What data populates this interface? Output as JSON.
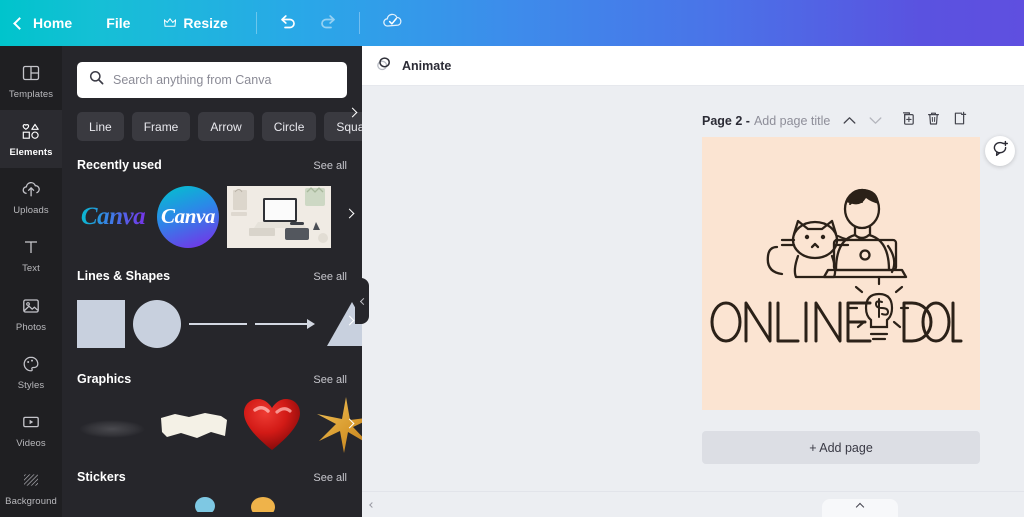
{
  "topbar": {
    "back_label": "Home",
    "back_icon": "chevron-left-icon",
    "file_label": "File",
    "resize_label": "Resize",
    "resize_icon": "crown-icon",
    "undo_icon": "undo-arrow-icon",
    "redo_icon": "redo-arrow-icon",
    "saved_icon": "cloud-check-icon",
    "gradient_start": "#00c4cc",
    "gradient_end": "#5f4fe0"
  },
  "rail": {
    "items": [
      {
        "label": "Templates",
        "icon": "templates-grid-icon",
        "active": false
      },
      {
        "label": "Elements",
        "icon": "elements-shapes-icon",
        "active": true
      },
      {
        "label": "Uploads",
        "icon": "upload-cloud-icon",
        "active": false
      },
      {
        "label": "Text",
        "icon": "text-t-icon",
        "active": false
      },
      {
        "label": "Photos",
        "icon": "photo-image-icon",
        "active": false
      },
      {
        "label": "Styles",
        "icon": "palette-icon",
        "active": false
      },
      {
        "label": "Videos",
        "icon": "video-play-icon",
        "active": false
      },
      {
        "label": "Background",
        "icon": "background-hatch-icon",
        "active": false
      }
    ]
  },
  "panel": {
    "search": {
      "placeholder": "Search anything from Canva",
      "value": "",
      "icon": "search-icon"
    },
    "chips": [
      "Line",
      "Frame",
      "Arrow",
      "Circle",
      "Square"
    ],
    "chips_more_icon": "chevron-right-icon",
    "see_all_label": "See all",
    "sections": [
      {
        "title": "Recently used",
        "items": [
          "canva-wordmark-thumb",
          "canva-circle-logo-thumb",
          "desk-laptop-photo-thumb"
        ],
        "next_icon": "chevron-right-icon"
      },
      {
        "title": "Lines & Shapes",
        "items": [
          "square-shape",
          "circle-shape",
          "line-shape",
          "arrow-shape",
          "triangle-shape"
        ],
        "next_icon": "chevron-right-icon"
      },
      {
        "title": "Graphics",
        "items": [
          "smudge-graphic",
          "torn-paper-graphic",
          "red-heart-graphic",
          "gold-sparkle-graphic"
        ],
        "next_icon": "chevron-right-icon"
      },
      {
        "title": "Stickers",
        "items": [
          "blue-sticker",
          "orange-sticker"
        ],
        "next_icon": "chevron-right-icon"
      }
    ],
    "canva_wordmark": "Canva",
    "canva_circlemark": "Canva",
    "collapse_icon": "chevron-left-icon"
  },
  "main": {
    "animate_label": "Animate",
    "animate_icon": "animate-circles-icon",
    "page": {
      "number_label": "Page 2 -",
      "title_placeholder": "Add page title",
      "collapse_up_icon": "chevron-up-icon",
      "collapse_down_icon": "chevron-down-icon",
      "duplicate_icon": "duplicate-page-icon",
      "delete_icon": "trash-icon",
      "addpage_inline_icon": "add-page-icon"
    },
    "artboard": {
      "background_color": "#fbe4d2",
      "logo_text_left": "ONLINE",
      "logo_text_right": "DOLLA",
      "logo_symbol": "lightbulb-dollar-icon",
      "illustration": "person-with-laptop-and-cat-icon"
    },
    "add_page_label": "+ Add page",
    "comment_icon": "add-comment-icon",
    "bottom_collapse_icon": "chevron-left-icon",
    "bottom_tab_icon": "chevron-up-icon"
  }
}
